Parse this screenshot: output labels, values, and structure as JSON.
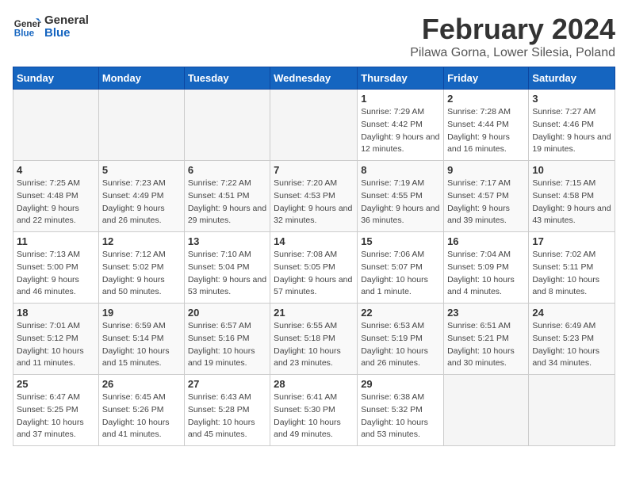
{
  "header": {
    "logo_general": "General",
    "logo_blue": "Blue",
    "month_year": "February 2024",
    "location": "Pilawa Gorna, Lower Silesia, Poland"
  },
  "days_of_week": [
    "Sunday",
    "Monday",
    "Tuesday",
    "Wednesday",
    "Thursday",
    "Friday",
    "Saturday"
  ],
  "weeks": [
    [
      {
        "day": "",
        "empty": true
      },
      {
        "day": "",
        "empty": true
      },
      {
        "day": "",
        "empty": true
      },
      {
        "day": "",
        "empty": true
      },
      {
        "day": "1",
        "sunrise": "7:29 AM",
        "sunset": "4:42 PM",
        "daylight": "9 hours and 12 minutes."
      },
      {
        "day": "2",
        "sunrise": "7:28 AM",
        "sunset": "4:44 PM",
        "daylight": "9 hours and 16 minutes."
      },
      {
        "day": "3",
        "sunrise": "7:27 AM",
        "sunset": "4:46 PM",
        "daylight": "9 hours and 19 minutes."
      }
    ],
    [
      {
        "day": "4",
        "sunrise": "7:25 AM",
        "sunset": "4:48 PM",
        "daylight": "9 hours and 22 minutes."
      },
      {
        "day": "5",
        "sunrise": "7:23 AM",
        "sunset": "4:49 PM",
        "daylight": "9 hours and 26 minutes."
      },
      {
        "day": "6",
        "sunrise": "7:22 AM",
        "sunset": "4:51 PM",
        "daylight": "9 hours and 29 minutes."
      },
      {
        "day": "7",
        "sunrise": "7:20 AM",
        "sunset": "4:53 PM",
        "daylight": "9 hours and 32 minutes."
      },
      {
        "day": "8",
        "sunrise": "7:19 AM",
        "sunset": "4:55 PM",
        "daylight": "9 hours and 36 minutes."
      },
      {
        "day": "9",
        "sunrise": "7:17 AM",
        "sunset": "4:57 PM",
        "daylight": "9 hours and 39 minutes."
      },
      {
        "day": "10",
        "sunrise": "7:15 AM",
        "sunset": "4:58 PM",
        "daylight": "9 hours and 43 minutes."
      }
    ],
    [
      {
        "day": "11",
        "sunrise": "7:13 AM",
        "sunset": "5:00 PM",
        "daylight": "9 hours and 46 minutes."
      },
      {
        "day": "12",
        "sunrise": "7:12 AM",
        "sunset": "5:02 PM",
        "daylight": "9 hours and 50 minutes."
      },
      {
        "day": "13",
        "sunrise": "7:10 AM",
        "sunset": "5:04 PM",
        "daylight": "9 hours and 53 minutes."
      },
      {
        "day": "14",
        "sunrise": "7:08 AM",
        "sunset": "5:05 PM",
        "daylight": "9 hours and 57 minutes."
      },
      {
        "day": "15",
        "sunrise": "7:06 AM",
        "sunset": "5:07 PM",
        "daylight": "10 hours and 1 minute."
      },
      {
        "day": "16",
        "sunrise": "7:04 AM",
        "sunset": "5:09 PM",
        "daylight": "10 hours and 4 minutes."
      },
      {
        "day": "17",
        "sunrise": "7:02 AM",
        "sunset": "5:11 PM",
        "daylight": "10 hours and 8 minutes."
      }
    ],
    [
      {
        "day": "18",
        "sunrise": "7:01 AM",
        "sunset": "5:12 PM",
        "daylight": "10 hours and 11 minutes."
      },
      {
        "day": "19",
        "sunrise": "6:59 AM",
        "sunset": "5:14 PM",
        "daylight": "10 hours and 15 minutes."
      },
      {
        "day": "20",
        "sunrise": "6:57 AM",
        "sunset": "5:16 PM",
        "daylight": "10 hours and 19 minutes."
      },
      {
        "day": "21",
        "sunrise": "6:55 AM",
        "sunset": "5:18 PM",
        "daylight": "10 hours and 23 minutes."
      },
      {
        "day": "22",
        "sunrise": "6:53 AM",
        "sunset": "5:19 PM",
        "daylight": "10 hours and 26 minutes."
      },
      {
        "day": "23",
        "sunrise": "6:51 AM",
        "sunset": "5:21 PM",
        "daylight": "10 hours and 30 minutes."
      },
      {
        "day": "24",
        "sunrise": "6:49 AM",
        "sunset": "5:23 PM",
        "daylight": "10 hours and 34 minutes."
      }
    ],
    [
      {
        "day": "25",
        "sunrise": "6:47 AM",
        "sunset": "5:25 PM",
        "daylight": "10 hours and 37 minutes."
      },
      {
        "day": "26",
        "sunrise": "6:45 AM",
        "sunset": "5:26 PM",
        "daylight": "10 hours and 41 minutes."
      },
      {
        "day": "27",
        "sunrise": "6:43 AM",
        "sunset": "5:28 PM",
        "daylight": "10 hours and 45 minutes."
      },
      {
        "day": "28",
        "sunrise": "6:41 AM",
        "sunset": "5:30 PM",
        "daylight": "10 hours and 49 minutes."
      },
      {
        "day": "29",
        "sunrise": "6:38 AM",
        "sunset": "5:32 PM",
        "daylight": "10 hours and 53 minutes."
      },
      {
        "day": "",
        "empty": true
      },
      {
        "day": "",
        "empty": true
      }
    ]
  ]
}
